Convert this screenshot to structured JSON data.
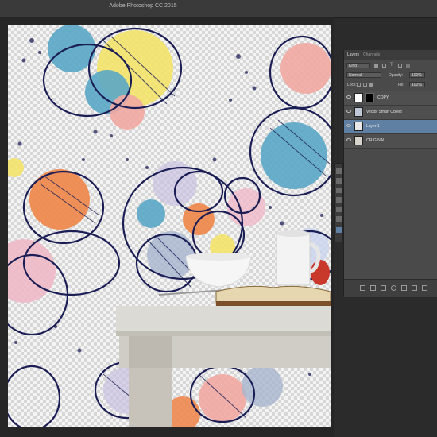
{
  "window": {
    "title": "Adobe Photoshop CC 2015"
  },
  "layers_panel": {
    "tabs": [
      {
        "label": "Layers"
      },
      {
        "label": "Channels"
      }
    ],
    "filter_label": "Kind",
    "blend_mode": "Normal",
    "opacity_label": "Opacity:",
    "opacity_value": "100%",
    "lock_label": "Lock:",
    "fill_label": "Fill:",
    "fill_value": "100%",
    "layers": [
      {
        "name": "COPY",
        "selected": false
      },
      {
        "name": "Vector Smart Object",
        "selected": false
      },
      {
        "name": "Layer 1",
        "selected": true
      },
      {
        "name": "ORIGINAL",
        "selected": false
      }
    ]
  },
  "colors": {
    "accent_selection": "#5f7fa3",
    "ui_bg": "#2b2b2b",
    "panel_bg": "#4a4a4a"
  },
  "icons": [
    "eye-icon",
    "link-icon",
    "fx-icon",
    "mask-icon",
    "adjustment-icon",
    "folder-icon",
    "new-layer-icon",
    "trash-icon"
  ]
}
